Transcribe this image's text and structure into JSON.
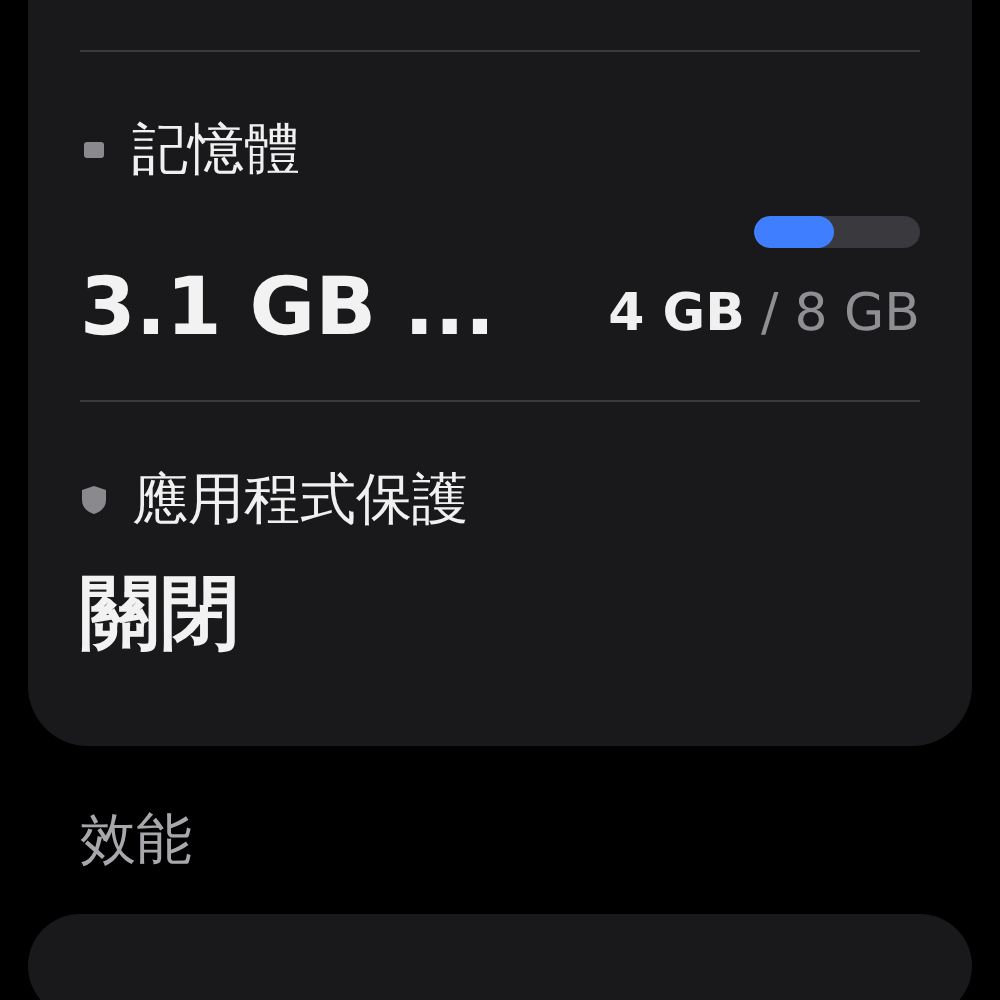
{
  "device_care": {
    "memory": {
      "title": "記憶體",
      "used": "3.1 GB ...",
      "level": 0.48,
      "in_use": "4 GB",
      "separator": "/",
      "total": "8 GB"
    },
    "app_protection": {
      "title": "應用程式保護",
      "value": "關閉"
    }
  },
  "performance": {
    "heading": "效能"
  }
}
